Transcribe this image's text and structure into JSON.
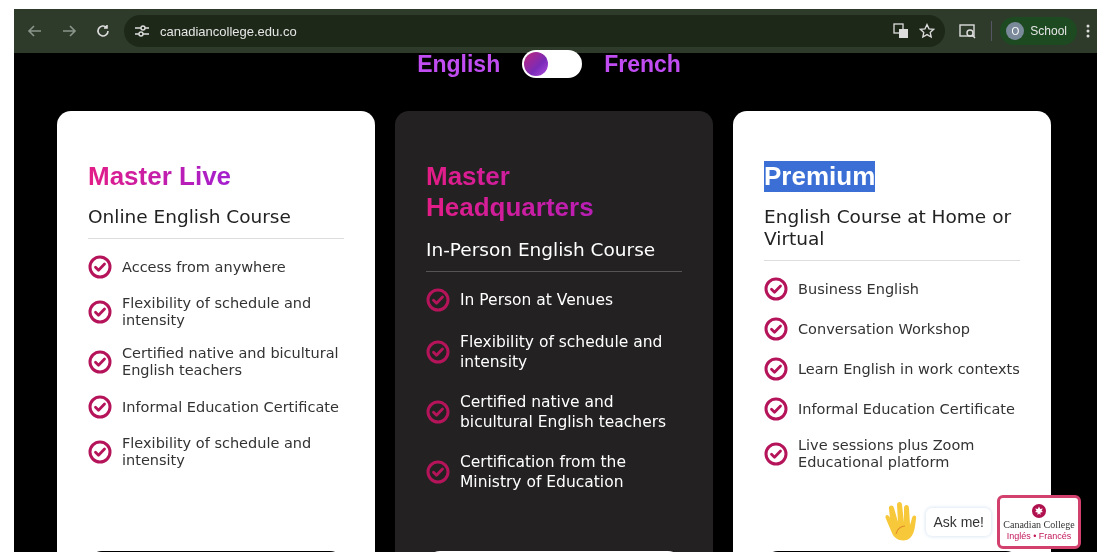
{
  "browser": {
    "url": "canadiancollege.edu.co",
    "profile": {
      "initial": "O",
      "name": "School"
    }
  },
  "language_switch": {
    "left_label": "English",
    "right_label": "French",
    "on": false
  },
  "plans": [
    {
      "kind": "light",
      "title": "Master Live",
      "title_highlighted": false,
      "subtitle": "Online English Course",
      "features": [
        "Access from anywhere",
        "Flexibility of schedule and intensity",
        "Certified native and bicultural English teachers",
        "Informal Education Certificate",
        "Flexibility of schedule and intensity"
      ]
    },
    {
      "kind": "dark",
      "title": "Master Headquarters",
      "title_highlighted": false,
      "subtitle": "In-Person English Course",
      "features": [
        "In Person at Venues",
        "Flexibility of schedule and intensity",
        "Certified native and bicultural English teachers",
        "Certification from the Ministry of Education"
      ]
    },
    {
      "kind": "light",
      "title": "Premium",
      "title_highlighted": true,
      "subtitle": "English Course at Home or Virtual",
      "features": [
        "Business English",
        "Conversation Workshop",
        "Learn English in work contexts",
        "Informal Education Certificate",
        "Live sessions plus Zoom Educational platform"
      ]
    }
  ],
  "chat_widget": {
    "bubble": "Ask me!",
    "logo_name": "Canadian College",
    "logo_tagline": "Inglés • Francés"
  }
}
